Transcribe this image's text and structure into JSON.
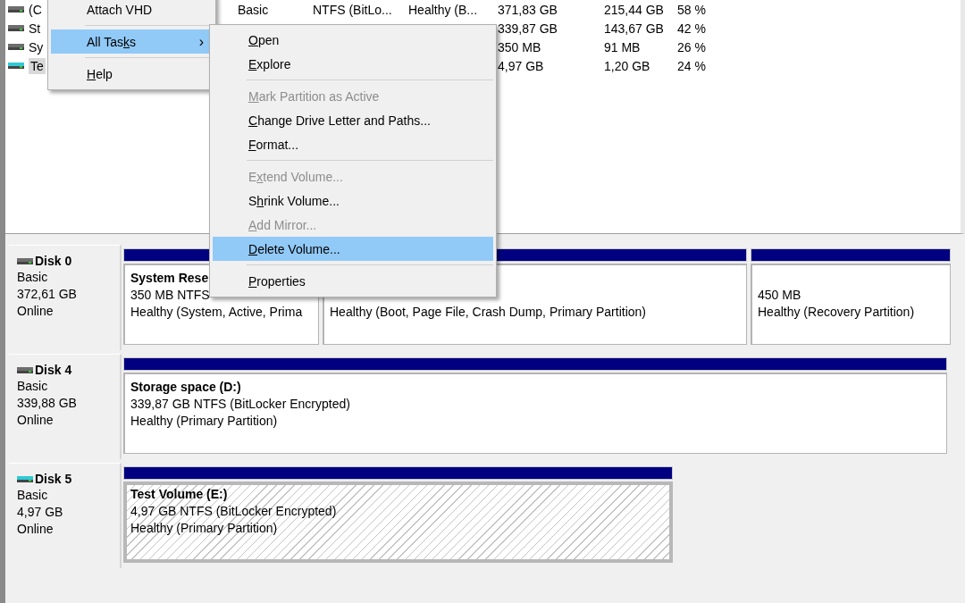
{
  "volume_list": {
    "rows": [
      {
        "kind": "fixed",
        "selected": false,
        "name": "(C",
        "layout": "Basic",
        "type": "NTFS (BitLo...",
        "status": "Healthy (B...",
        "capacity": "371,83 GB",
        "free": "215,44 GB",
        "percent_free": "58 %"
      },
      {
        "kind": "fixed",
        "selected": false,
        "name": "St",
        "capacity": "339,87 GB",
        "free": "143,67 GB",
        "percent_free": "42 %"
      },
      {
        "kind": "fixed",
        "selected": false,
        "name": "Sy",
        "capacity": "350 MB",
        "free": "91 MB",
        "percent_free": "26 %"
      },
      {
        "kind": "virtual",
        "selected": true,
        "name": "Te",
        "capacity": "4,97 GB",
        "free": "1,20 GB",
        "percent_free": "24 %"
      }
    ]
  },
  "context_menu": {
    "items": [
      {
        "kind": "item",
        "label": {
          "before": "Attach VHD"
        },
        "selected": false,
        "disabled": false
      },
      {
        "kind": "separator"
      },
      {
        "kind": "item",
        "label": {
          "before": "All Tas",
          "key": "k",
          "after": "s"
        },
        "selected": true,
        "disabled": false,
        "submenu": true,
        "arrow": "›"
      },
      {
        "kind": "separator"
      },
      {
        "kind": "item",
        "label": {
          "key": "H",
          "after": "elp"
        },
        "selected": false,
        "disabled": false
      }
    ]
  },
  "submenu": {
    "items": [
      {
        "kind": "item",
        "label": {
          "key": "O",
          "after": "pen"
        },
        "selected": false,
        "disabled": false
      },
      {
        "kind": "item",
        "label": {
          "key": "E",
          "after": "xplore"
        },
        "selected": false,
        "disabled": false
      },
      {
        "kind": "separator"
      },
      {
        "kind": "item",
        "label": {
          "key": "M",
          "after": "ark Partition as Active"
        },
        "selected": false,
        "disabled": true
      },
      {
        "kind": "item",
        "label": {
          "key": "C",
          "after": "hange Drive Letter and Paths..."
        },
        "selected": false,
        "disabled": false
      },
      {
        "kind": "item",
        "label": {
          "key": "F",
          "after": "ormat..."
        },
        "selected": false,
        "disabled": false
      },
      {
        "kind": "separator"
      },
      {
        "kind": "item",
        "label": {
          "before": "E",
          "key": "x",
          "after": "tend Volume..."
        },
        "selected": false,
        "disabled": true
      },
      {
        "kind": "item",
        "label": {
          "before": "S",
          "key": "h",
          "after": "rink Volume..."
        },
        "selected": false,
        "disabled": false
      },
      {
        "kind": "item",
        "label": {
          "key": "A",
          "after": "dd Mirror..."
        },
        "selected": false,
        "disabled": true
      },
      {
        "kind": "item",
        "label": {
          "key": "D",
          "after": "elete Volume..."
        },
        "selected": true,
        "disabled": false
      },
      {
        "kind": "separator"
      },
      {
        "kind": "item",
        "label": {
          "key": "P",
          "after": "roperties"
        },
        "selected": false,
        "disabled": false
      }
    ]
  },
  "disks": [
    {
      "kind": "fixed",
      "name": "Disk 0",
      "type": "Basic",
      "size": "372,61 GB",
      "status": "Online",
      "partitions": [
        {
          "selected": false,
          "title": "System Rese",
          "size": "350 MB NTFS",
          "status": "Healthy (System, Active, Prima"
        },
        {
          "selected": false,
          "status": "Healthy (Boot, Page File, Crash Dump, Primary Partition)"
        },
        {
          "selected": false,
          "size": "450 MB",
          "status": "Healthy (Recovery Partition)"
        }
      ]
    },
    {
      "kind": "fixed",
      "name": "Disk 4",
      "type": "Basic",
      "size": "339,88 GB",
      "status": "Online",
      "partitions": [
        {
          "selected": false,
          "title": "Storage space  (D:)",
          "size": "339,87 GB NTFS (BitLocker Encrypted)",
          "status": "Healthy (Primary Partition)"
        }
      ]
    },
    {
      "kind": "virtual",
      "name": "Disk 5",
      "type": "Basic",
      "size": "4,97 GB",
      "status": "Online",
      "partitions": [
        {
          "selected": true,
          "title": "Test Volume  (E:)",
          "size": "4,97 GB NTFS (BitLocker Encrypted)",
          "status": "Healthy (Primary Partition)"
        }
      ]
    }
  ]
}
